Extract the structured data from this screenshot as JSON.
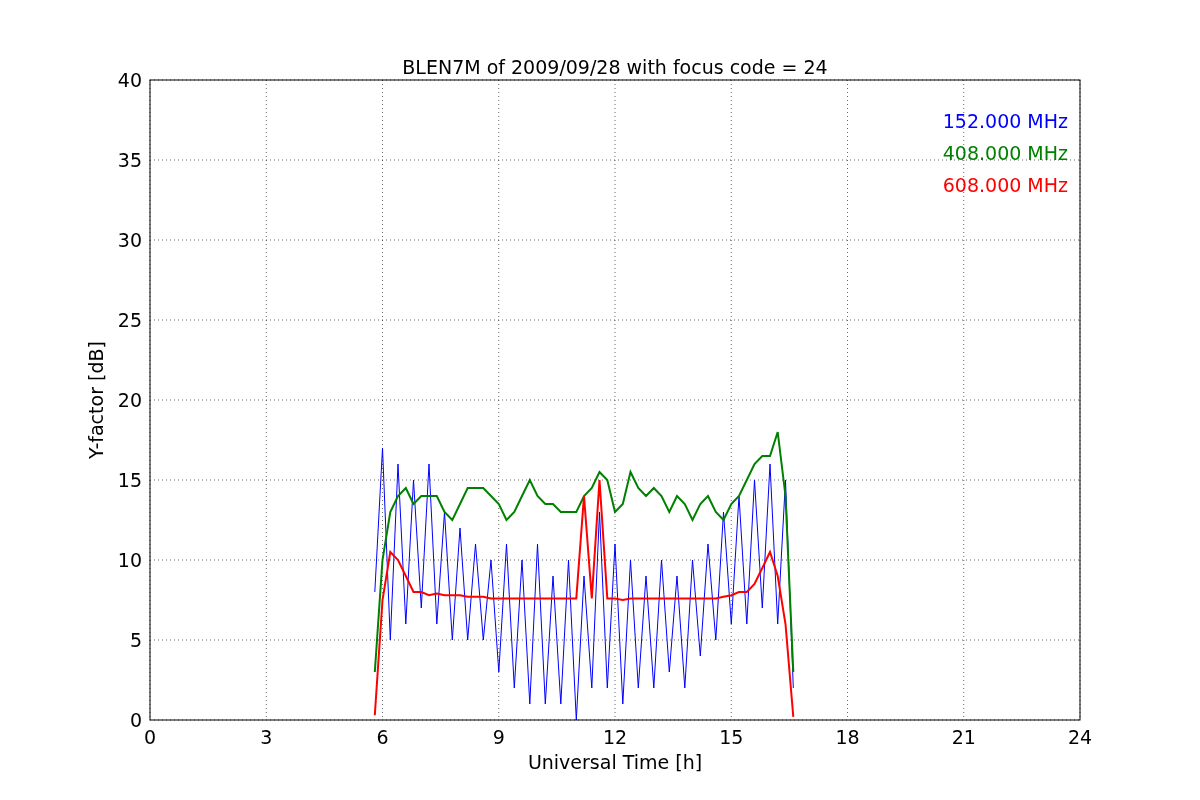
{
  "figure": {
    "chart_data": {
      "type": "line",
      "title": "BLEN7M of 2009/09/28 with focus code = 24",
      "xlabel": "Universal Time [h]",
      "ylabel": "Y-factor [dB]",
      "x": [
        5.8,
        6.0,
        6.2,
        6.4,
        6.6,
        6.8,
        7.0,
        7.2,
        7.4,
        7.6,
        7.8,
        8.0,
        8.2,
        8.4,
        8.6,
        8.8,
        9.0,
        9.2,
        9.4,
        9.6,
        9.8,
        10.0,
        10.2,
        10.4,
        10.6,
        10.8,
        11.0,
        11.2,
        11.4,
        11.6,
        11.8,
        12.0,
        12.2,
        12.4,
        12.6,
        12.8,
        13.0,
        13.2,
        13.4,
        13.6,
        13.8,
        14.0,
        14.2,
        14.4,
        14.6,
        14.8,
        15.0,
        15.2,
        15.4,
        15.6,
        15.8,
        16.0,
        16.2,
        16.4,
        16.6
      ],
      "series": [
        {
          "name": "152.000 MHz",
          "color": "#0000ff",
          "values": [
            8,
            17,
            5,
            16,
            6,
            15,
            7,
            16,
            6,
            13,
            5,
            12,
            5,
            11,
            5,
            10,
            3,
            11,
            2,
            10,
            1,
            11,
            1,
            9,
            1,
            10,
            0,
            9,
            2,
            13,
            2,
            11,
            1,
            10,
            2,
            9,
            2,
            10,
            3,
            9,
            2,
            10,
            4,
            11,
            5,
            13,
            6,
            14,
            6,
            15,
            7,
            16,
            6,
            15,
            2
          ]
        },
        {
          "name": "408.000 MHz",
          "color": "#008000",
          "values": [
            3,
            10,
            13,
            14,
            14.5,
            13.5,
            14,
            14,
            14,
            13,
            12.5,
            13.5,
            14.5,
            14.5,
            14.5,
            14,
            13.5,
            12.5,
            13,
            14,
            15,
            14,
            13.5,
            13.5,
            13,
            13,
            13,
            14,
            14.5,
            15.5,
            15,
            13,
            13.5,
            15.5,
            14.5,
            14,
            14.5,
            14,
            13,
            14,
            13.5,
            12.5,
            13.5,
            14,
            13,
            12.5,
            13.5,
            14,
            15,
            16,
            16.5,
            16.5,
            18,
            14,
            3
          ]
        },
        {
          "name": "608.000 MHz",
          "color": "#ff0000",
          "values": [
            0.3,
            7.5,
            10.5,
            10,
            9,
            8,
            8,
            7.8,
            7.9,
            7.8,
            7.8,
            7.8,
            7.7,
            7.7,
            7.7,
            7.6,
            7.6,
            7.6,
            7.6,
            7.6,
            7.6,
            7.6,
            7.6,
            7.6,
            7.6,
            7.6,
            7.6,
            14,
            7.6,
            15,
            7.6,
            7.6,
            7.5,
            7.6,
            7.6,
            7.6,
            7.6,
            7.6,
            7.6,
            7.6,
            7.6,
            7.6,
            7.6,
            7.6,
            7.6,
            7.7,
            7.8,
            8,
            8,
            8.5,
            9.5,
            10.5,
            9,
            6,
            0.2
          ]
        }
      ],
      "grid": true,
      "xlim": [
        0,
        24
      ],
      "ylim": [
        0,
        40
      ],
      "xticks": [
        0,
        3,
        6,
        9,
        12,
        15,
        18,
        21,
        24
      ],
      "yticks": [
        0,
        5,
        10,
        15,
        20,
        25,
        30,
        35,
        40
      ]
    }
  }
}
